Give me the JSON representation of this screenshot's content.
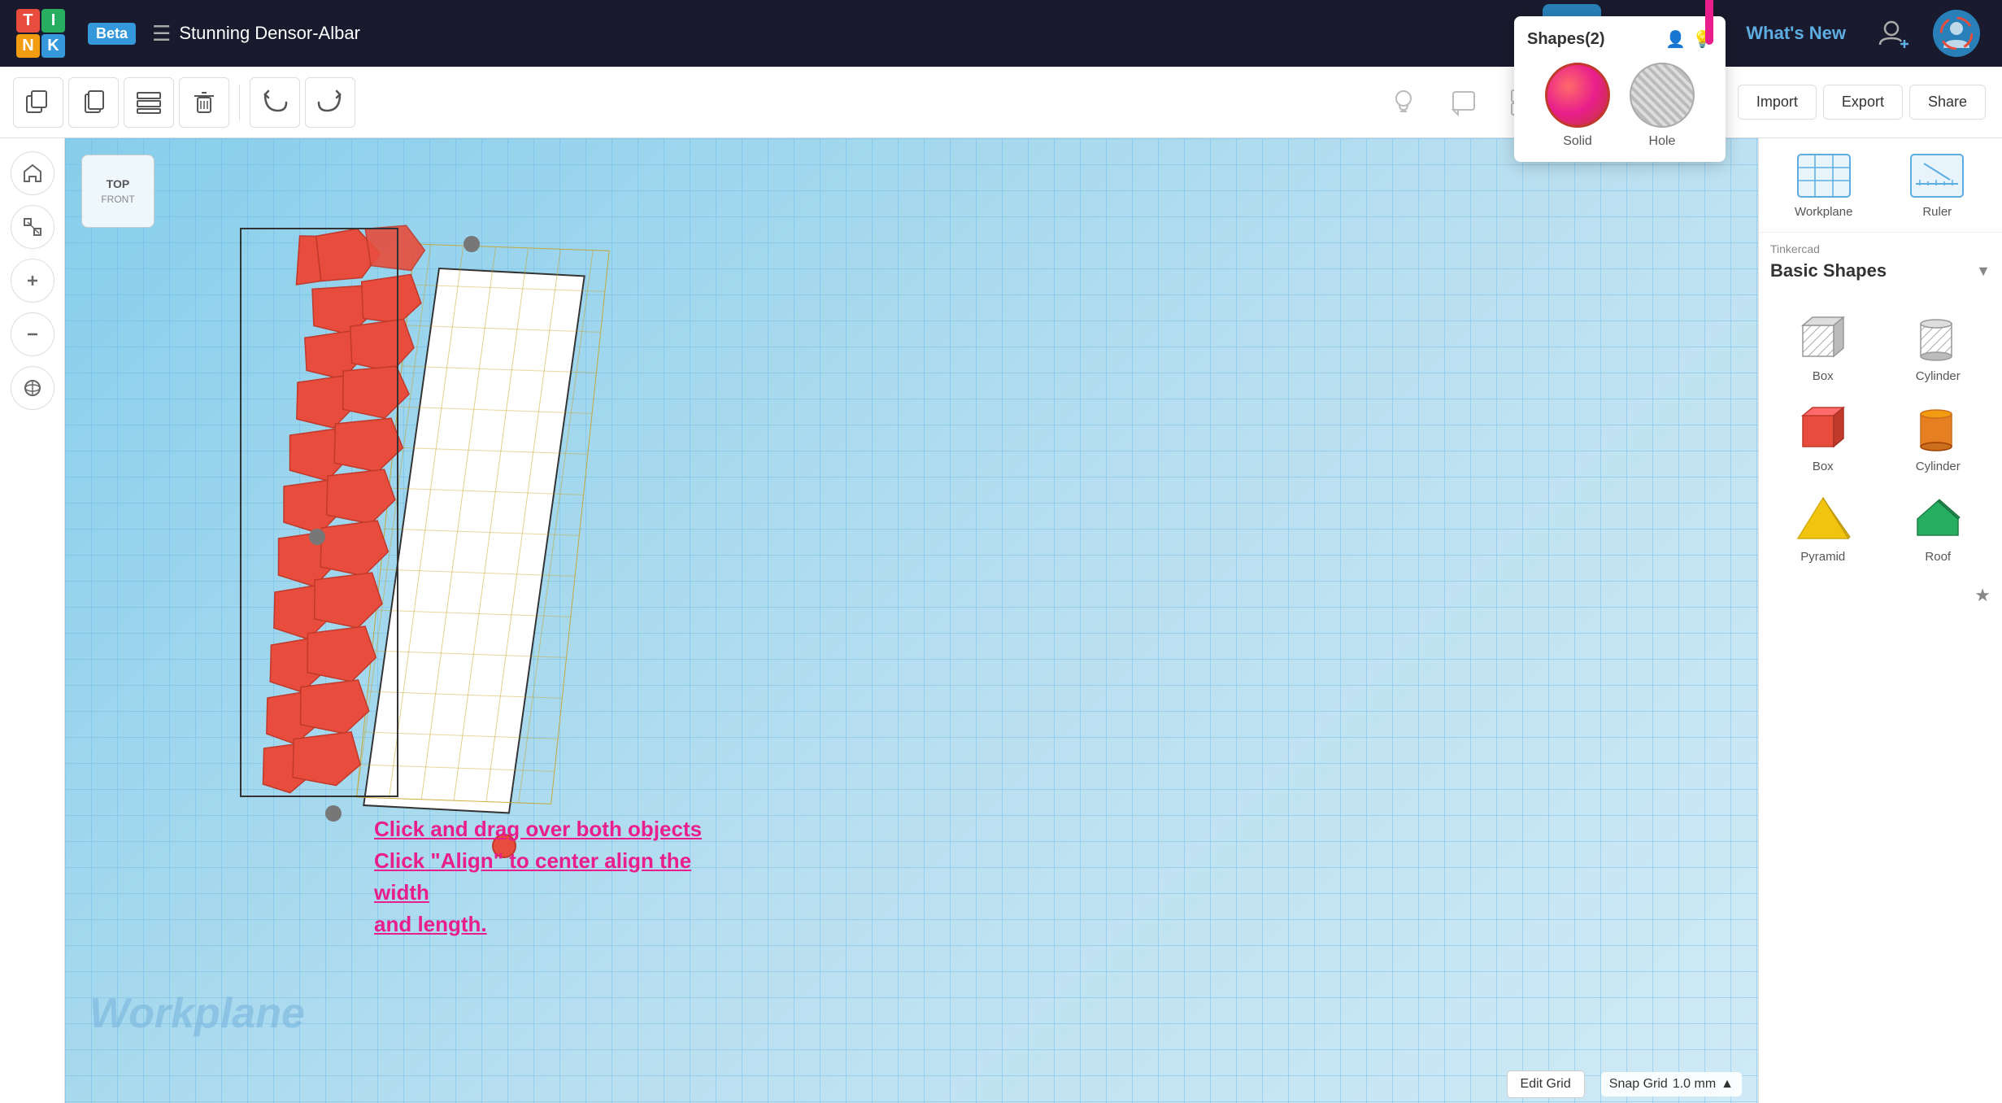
{
  "app": {
    "title": "Tinkercad",
    "beta_label": "Beta",
    "logo_letters": [
      "T",
      "I",
      "N",
      "K"
    ]
  },
  "header": {
    "project_icon": "☰",
    "project_name": "Stunning Densor-Albar",
    "whats_new": "What's New",
    "import_label": "Import",
    "export_label": "Export",
    "share_label": "Share"
  },
  "toolbar": {
    "duplicate_tooltip": "Duplicate",
    "copy_tooltip": "Copy",
    "paste_tooltip": "Paste",
    "delete_tooltip": "Delete",
    "undo_tooltip": "Undo",
    "redo_tooltip": "Redo",
    "hide_icon": "💡",
    "note_icon": "⬜",
    "group_icon": "⬛",
    "align_icon": "⊞",
    "mirror_icon": "⊟",
    "import_btn": "Import",
    "export_btn": "Export",
    "share_btn": "Share"
  },
  "shapes_panel": {
    "title": "Shapes(2)",
    "solid_label": "Solid",
    "hole_label": "Hole"
  },
  "right_panel": {
    "category": "Tinkercad",
    "title": "Basic Shapes",
    "workplane_label": "Workplane",
    "ruler_label": "Ruler",
    "shapes": [
      {
        "label": "Box",
        "type": "gray-box",
        "row": 0
      },
      {
        "label": "Cylinder",
        "type": "gray-cyl",
        "row": 0
      },
      {
        "label": "Box",
        "type": "red-box",
        "row": 1
      },
      {
        "label": "Cylinder",
        "type": "orange-cyl",
        "row": 1
      },
      {
        "label": "Pyramid",
        "type": "yellow-pyramid",
        "row": 2
      },
      {
        "label": "Roof",
        "type": "green-roof",
        "row": 2
      }
    ]
  },
  "canvas": {
    "nav_cube_top": "TOP",
    "nav_cube_front": "FRONT",
    "workplane_text": "Workplane",
    "instruction": "Click and drag over both objects\nClick \"Align\" to center align the width\nand length.",
    "edit_grid_label": "Edit Grid",
    "snap_grid_label": "Snap Grid",
    "snap_grid_value": "1.0 mm",
    "snap_grid_arrow": "▲"
  }
}
